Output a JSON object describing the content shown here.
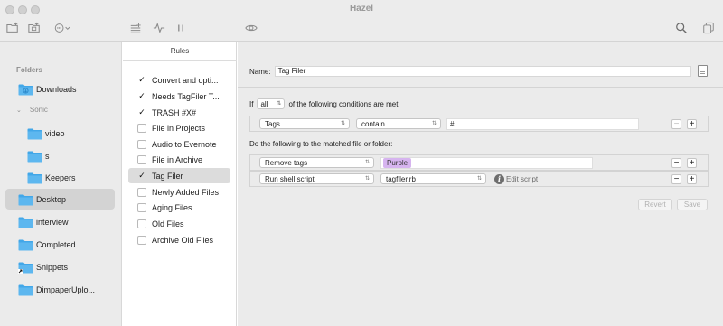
{
  "window": {
    "title": "Hazel"
  },
  "colors": {
    "folder_blue": "#42a7e8",
    "tag_purple": "#d6b4ef",
    "selected_bg": "#d3d3d3"
  },
  "toolbar": {
    "icons": [
      "new-folder-icon",
      "folder-settings-icon",
      "more-options-icon",
      "rule-list-icon",
      "activity-icon",
      "pause-icon",
      "preview-icon",
      "search-icon",
      "duplicate-icon"
    ]
  },
  "sidebar": {
    "header": "Folders",
    "items": [
      {
        "label": "Downloads",
        "icon": "downloads-folder-icon"
      },
      {
        "label": "Sonic",
        "icon": "chevron-down-icon"
      },
      {
        "label": "video",
        "icon": "folder-icon"
      },
      {
        "label": "s",
        "icon": "folder-icon"
      },
      {
        "label": "Keepers",
        "icon": "folder-icon"
      },
      {
        "label": "Desktop",
        "icon": "folder-icon"
      },
      {
        "label": "interview",
        "icon": "folder-icon"
      },
      {
        "label": "Completed",
        "icon": "folder-icon"
      },
      {
        "label": "Snippets",
        "icon": "alias-folder-icon"
      },
      {
        "label": "DimpaperUplo...",
        "icon": "folder-icon"
      }
    ]
  },
  "rules": {
    "header": "Rules",
    "items": [
      {
        "label": "Convert and opti...",
        "checked": true
      },
      {
        "label": "Needs TagFiler T...",
        "checked": true
      },
      {
        "label": "TRASH #X#",
        "checked": true
      },
      {
        "label": "File in Projects",
        "checked": false
      },
      {
        "label": "Audio to Evernote",
        "checked": false
      },
      {
        "label": "File in Archive",
        "checked": false
      },
      {
        "label": "Tag Filer",
        "checked": true
      },
      {
        "label": "Newly Added Files",
        "checked": false
      },
      {
        "label": "Aging Files",
        "checked": false
      },
      {
        "label": "Old Files",
        "checked": false
      },
      {
        "label": "Archive Old Files",
        "checked": false
      }
    ],
    "checkmark": "✓"
  },
  "editor": {
    "name_label": "Name:",
    "name_value": "Tag Filer",
    "if_prefix": "If",
    "if_match": "all",
    "if_suffix": "of the following conditions are met",
    "condition": {
      "attribute": "Tags",
      "operator": "contain",
      "value": "#"
    },
    "do_label": "Do the following to the matched file or folder:",
    "actions": [
      {
        "action": "Remove tags",
        "tag": "Purple"
      },
      {
        "action": "Run shell script",
        "script": "tagfiler.rb",
        "info": "i",
        "edit_label": "Edit script"
      }
    ],
    "minus": "−",
    "plus": "+",
    "revert_label": "Revert",
    "save_label": "Save"
  }
}
